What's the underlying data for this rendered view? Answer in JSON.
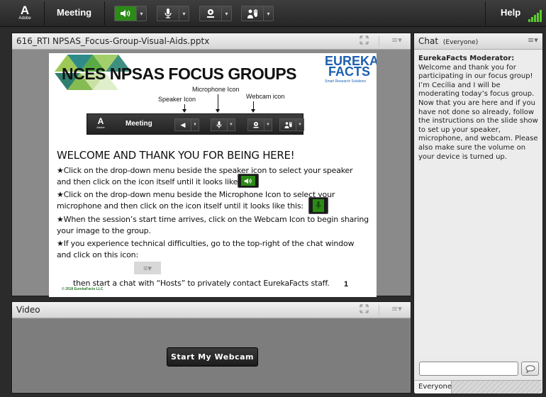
{
  "toolbar": {
    "logo_letter": "A",
    "logo_text": "Adobe",
    "meeting_label": "Meeting",
    "help_label": "Help",
    "speaker_icon": "speaker-icon",
    "microphone_icon": "microphone-icon",
    "webcam_icon": "webcam-icon",
    "raise_hand_icon": "raise-hand-icon",
    "dropdown_glyph": "▾",
    "speaker_state": "on",
    "accent_color": "#2c8a16"
  },
  "share_pod": {
    "title": "616_RTI NPSAS_Focus-Group-Visual-Aids.pptx",
    "fullscreen_icon": "fullscreen-icon",
    "menu_glyph": "≡▾",
    "slide": {
      "title": "NCES NPSAS FOCUS GROUPS",
      "logo_line1": "EUREKA",
      "logo_line2": "FACTS",
      "logo_tagline": "Smart Research Solutions",
      "label_speaker": "Speaker Icon",
      "label_microphone": "Microphone Icon",
      "label_webcam": "Webcam icon",
      "mini_toolbar_logo": "A",
      "mini_toolbar_logo_text": "Adobe",
      "mini_toolbar_meeting": "Meeting",
      "welcome": "WELCOME AND THANK YOU FOR BEING HERE!",
      "bullets": [
        "★Click on the drop-down menu beside the speaker icon to select your speaker and then click on the icon itself until it looks like this:",
        "★Click on the drop-down menu beside the Microphone Icon to select your microphone and then click on the icon itself until it looks like this:",
        "★When the session’s start time arrives, click on the Webcam Icon to begin sharing your image to the group.",
        "★If you experience technical difficulties, go to the top-right of the chat window and click on this icon:"
      ],
      "last_line": "then start a chat with “Hosts” to privately contact EurekaFacts staff.",
      "copyright": "© 2018 EurekaFacts LLC",
      "page_number": "1"
    }
  },
  "video_pod": {
    "title": "Video",
    "start_button": "Start My Webcam"
  },
  "chat_pod": {
    "title": "Chat",
    "scope": "(Everyone)",
    "menu_glyph": "≡▾",
    "messages": [
      {
        "sender": "EurekaFacts Moderator:",
        "text": "Welcome and thank you for participating in our focus group! I’m Cecilia and I will be moderating today’s focus group. Now that you are here and if you have not done so already, follow the instructions on the slide show to set up your speaker, microphone, and webcam. Please also make sure the volume on your device is turned up."
      }
    ],
    "input_value": "",
    "send_icon": "chat-bubble-icon",
    "tab_label": "Everyone"
  }
}
